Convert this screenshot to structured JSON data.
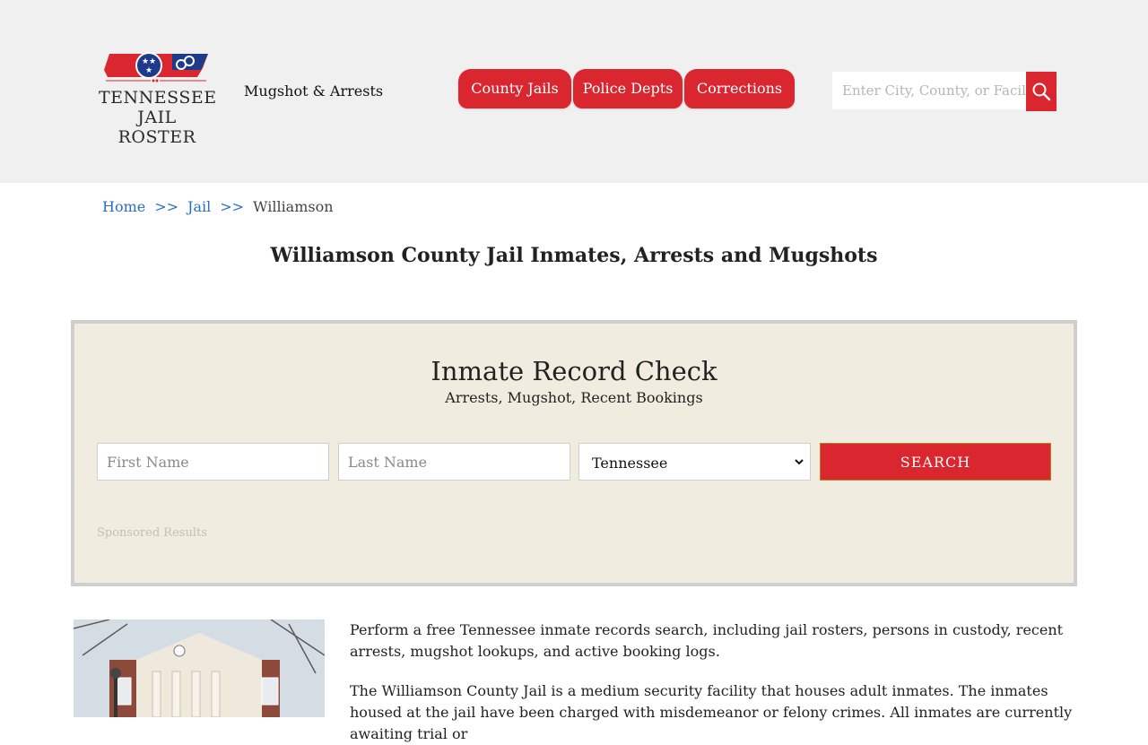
{
  "header": {
    "logo": {
      "line1": "TENNESSEE",
      "line2": "JAIL ROSTER"
    },
    "tagline": "Mugshot & Arrests",
    "nav": [
      {
        "label": "County Jails"
      },
      {
        "label": "Police Depts"
      },
      {
        "label": "Corrections"
      }
    ],
    "search": {
      "placeholder": "Enter City, County, or Facility"
    }
  },
  "breadcrumb": {
    "home": "Home",
    "sep": ">>",
    "jail": "Jail",
    "current": "Williamson"
  },
  "page_title": "Williamson County Jail Inmates, Arrests and Mugshots",
  "record_check": {
    "title": "Inmate Record Check",
    "subtitle": "Arrests, Mugshot, Recent Bookings",
    "first_name_placeholder": "First Name",
    "last_name_placeholder": "Last Name",
    "state_selected": "Tennessee",
    "search_button": "SEARCH",
    "sponsored": "Sponsored Results"
  },
  "content": {
    "paragraph1": "Perform a free Tennessee inmate records search, including jail rosters, persons in custody, recent arrests, mugshot lookups, and active booking logs.",
    "paragraph2": "The Williamson County Jail is a medium security facility that houses adult inmates. The inmates housed at the jail have been charged with misdemeanor or felony crimes. All inmates are currently awaiting trial or"
  },
  "colors": {
    "accent_red": "#d9262f",
    "header_bg": "#f0f0f0",
    "panel_bg": "#f0ece0",
    "link_blue": "#2a6fbf"
  }
}
